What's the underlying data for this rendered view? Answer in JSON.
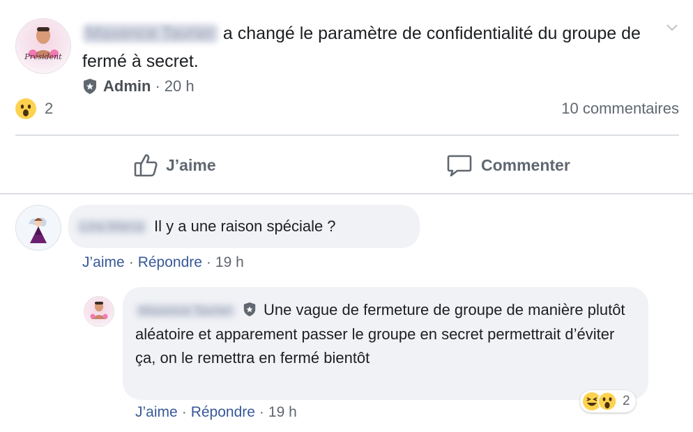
{
  "post": {
    "author_name": "Maxence Tavrier",
    "action_text": "a changé le paramètre de confidentialité du groupe de fermé à secret.",
    "badge_label": "Admin",
    "time": "20 h",
    "reaction_count": "2",
    "comments_count": "10 commentaires",
    "avatar_text": "Président"
  },
  "actions": {
    "like_label": "J’aime",
    "comment_label": "Commenter"
  },
  "comments": [
    {
      "author_name": "Lina Marca",
      "text": "Il y a une raison spéciale ?",
      "like_label": "J’aime",
      "reply_label": "Répondre",
      "separator": "·",
      "time": "19 h"
    }
  ],
  "reply": {
    "author_name": "Maxence Tavrier",
    "text": "Une vague de fermeture de groupe de manière plutôt aléatoire et apparement passer le groupe en secret permettrait d’éviter ça, on le remettra en fermé bientôt",
    "like_label": "J’aime",
    "reply_label": "Répondre",
    "separator": "·",
    "time": "19 h",
    "reaction_count": "2"
  },
  "icons": {
    "admin_badge": "shield-star-icon",
    "menu": "chevron-down-icon",
    "like": "thumbs-up-icon",
    "comment": "speech-bubble-icon",
    "reaction_wow": "wow-emoji-icon",
    "reaction_haha": "haha-emoji-icon"
  },
  "colors": {
    "link": "#385898",
    "meta": "#606770",
    "bubble": "#f0f2f5",
    "divider": "#dadde1"
  }
}
